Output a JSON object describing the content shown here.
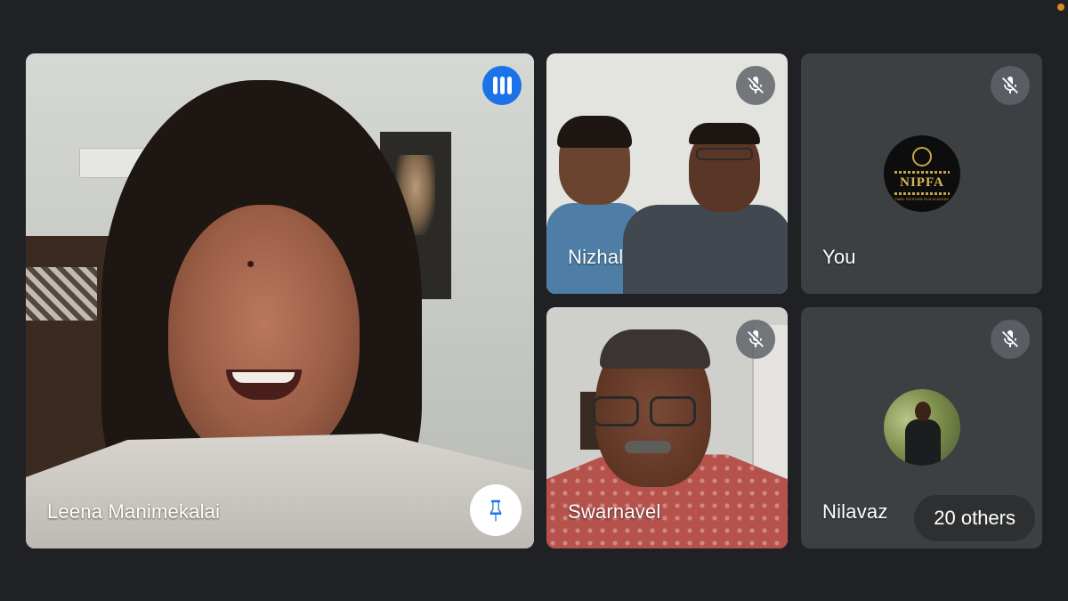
{
  "window": {
    "recording_indicator_color": "#d98a1f"
  },
  "main": {
    "participant_name": "Leena Manimekalai",
    "speaking_icon": "audio-levels-icon",
    "pin_icon": "pin-icon",
    "accent_color": "#1a73e8"
  },
  "participants": [
    {
      "name": "Nizhal",
      "mic_icon": "mic-off-icon"
    },
    {
      "name": "You",
      "mic_icon": "mic-off-icon",
      "logo_text": "NIPFA",
      "logo_subtext": "TAMIL PATHIYAM FILM ACADEMY"
    },
    {
      "name": "Swarnavel",
      "mic_icon": "mic-off-icon"
    },
    {
      "name": "Nilavaz",
      "mic_icon": "mic-off-icon"
    }
  ],
  "overflow": {
    "label": "20 others"
  }
}
